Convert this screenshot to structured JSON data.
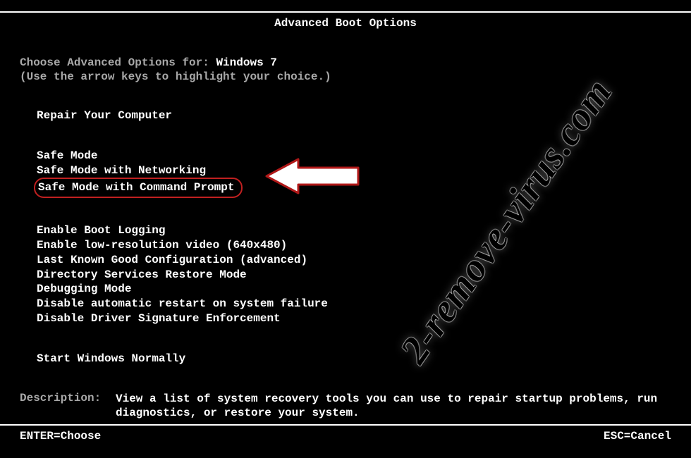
{
  "title": "Advanced Boot Options",
  "choose_prefix": "Choose Advanced Options for: ",
  "os_name": "Windows 7",
  "hint": "(Use the arrow keys to highlight your choice.)",
  "group1": [
    "Repair Your Computer"
  ],
  "group2": [
    "Safe Mode",
    "Safe Mode with Networking",
    "Safe Mode with Command Prompt"
  ],
  "group3": [
    "Enable Boot Logging",
    "Enable low-resolution video (640x480)",
    "Last Known Good Configuration (advanced)",
    "Directory Services Restore Mode",
    "Debugging Mode",
    "Disable automatic restart on system failure",
    "Disable Driver Signature Enforcement"
  ],
  "group4": [
    "Start Windows Normally"
  ],
  "highlighted_index": 2,
  "description_label": "Description:",
  "description_text": "View a list of system recovery tools you can use to repair startup problems, run diagnostics, or restore your system.",
  "footer_left": "ENTER=Choose",
  "footer_right": "ESC=Cancel",
  "watermark": "2-remove-virus.com"
}
